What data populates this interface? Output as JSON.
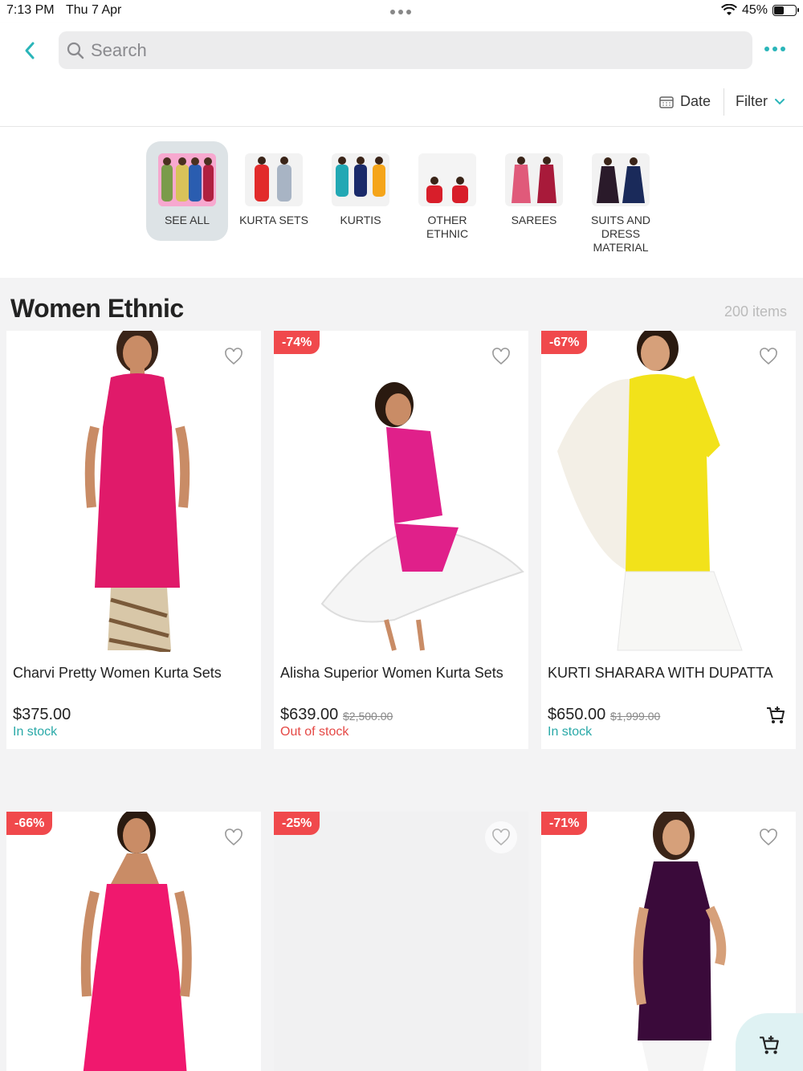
{
  "status": {
    "time": "7:13 PM",
    "date": "Thu 7 Apr",
    "battery": "45%"
  },
  "search": {
    "placeholder": "Search"
  },
  "toolbar": {
    "date_label": "Date",
    "filter_label": "Filter"
  },
  "categories": [
    {
      "label": "SEE ALL",
      "active": true
    },
    {
      "label": "KURTA SETS"
    },
    {
      "label": "KURTIS"
    },
    {
      "label": "OTHER ETHNIC"
    },
    {
      "label": "SAREES"
    },
    {
      "label": "SUITS AND DRESS MATERIAL"
    }
  ],
  "section": {
    "title": "Women Ethnic",
    "count": "200 items"
  },
  "products": [
    {
      "title": "Charvi Pretty Women Kurta Sets",
      "price": "$375.00",
      "old_price": "",
      "stock": "In stock",
      "badge": ""
    },
    {
      "title": "Alisha Superior Women Kurta Sets",
      "price": "$639.00",
      "old_price": "$2,500.00",
      "stock": "Out of stock",
      "badge": "-74%"
    },
    {
      "title": "KURTI SHARARA WITH DUPATTA",
      "price": "$650.00",
      "old_price": "$1,999.00",
      "stock": "In stock",
      "badge": "-67%"
    },
    {
      "badge": "-66%"
    },
    {
      "badge": "-25%"
    },
    {
      "badge": "-71%"
    }
  ],
  "colors": {
    "accent": "#2ab5b9",
    "badge": "#f0494c",
    "in_stock": "#2aa9a8",
    "out_of_stock": "#e54845"
  }
}
